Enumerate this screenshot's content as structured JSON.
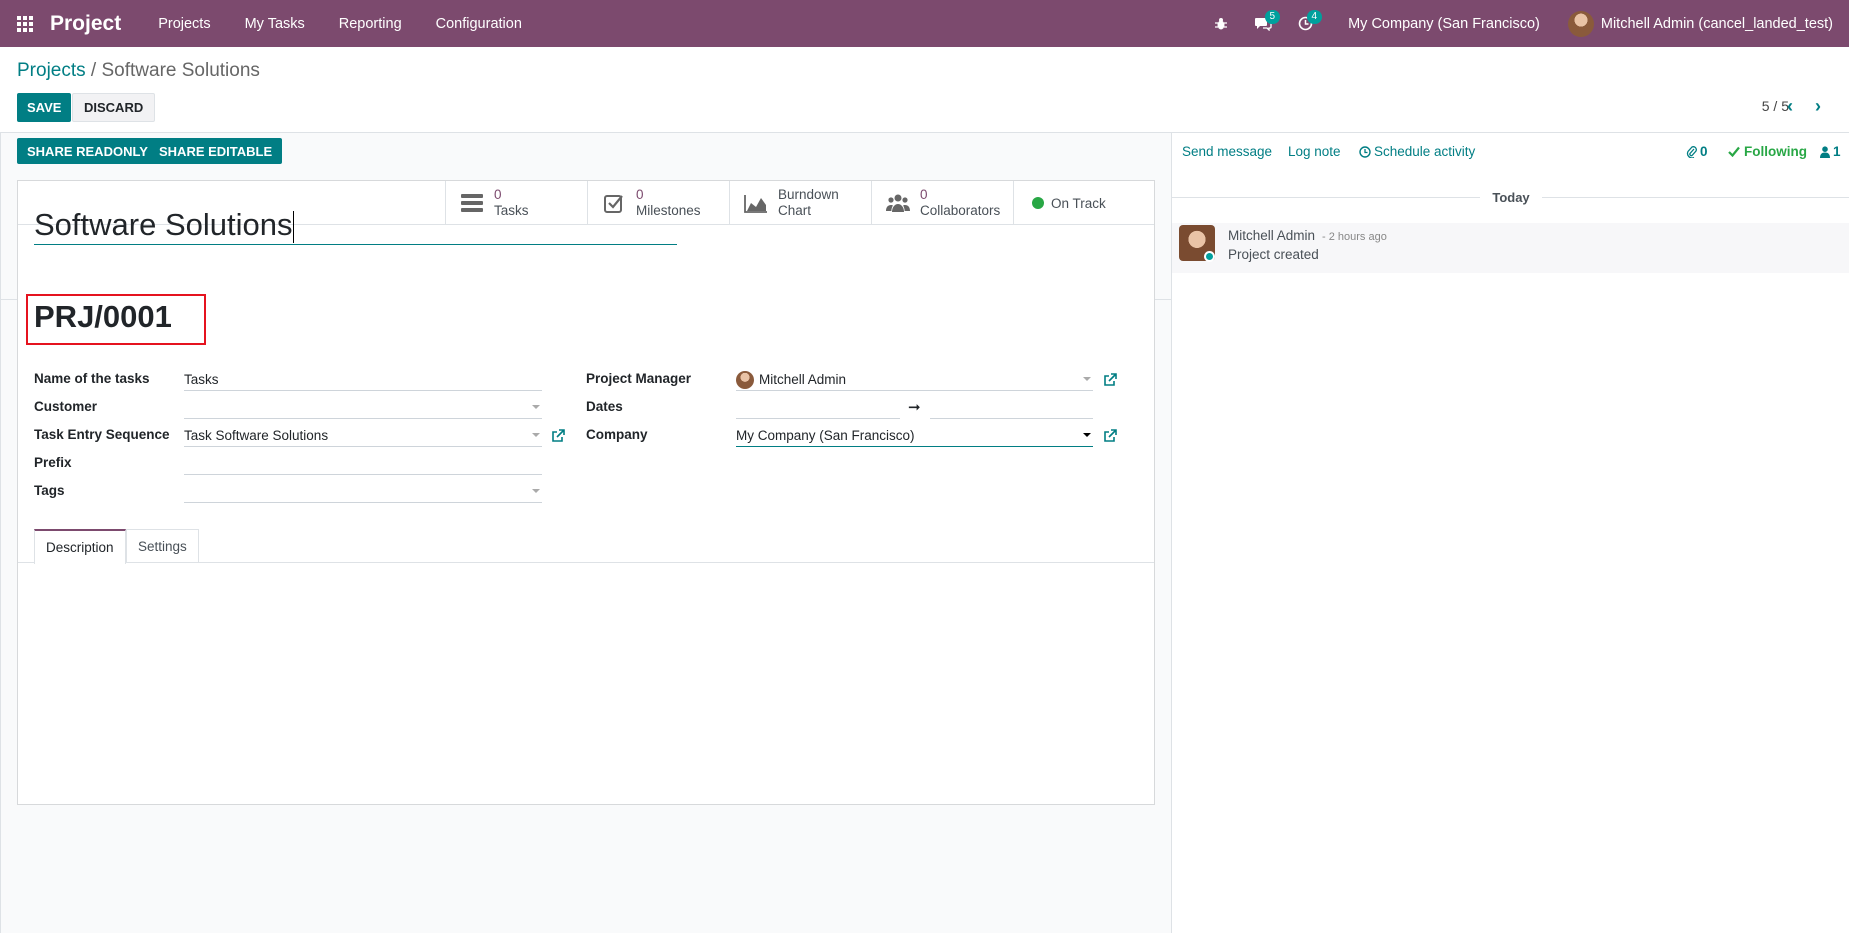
{
  "navbar": {
    "brand": "Project",
    "menu": [
      "Projects",
      "My Tasks",
      "Reporting",
      "Configuration"
    ],
    "messages_badge": "5",
    "activities_badge": "4",
    "company": "My Company (San Francisco)",
    "user": "Mitchell Admin (cancel_landed_test)"
  },
  "breadcrumb": {
    "parent": "Projects",
    "separator": "/",
    "current": "Software Solutions"
  },
  "buttons": {
    "save": "SAVE",
    "discard": "DISCARD",
    "share_readonly": "SHARE READONLY",
    "share_editable": "SHARE EDITABLE"
  },
  "pager": {
    "value": "5 / 5"
  },
  "stat_buttons": {
    "tasks": {
      "count": "0",
      "label": "Tasks"
    },
    "milestones": {
      "count": "0",
      "label": "Milestones"
    },
    "burndown": {
      "line1": "Burndown",
      "line2": "Chart"
    },
    "collaborators": {
      "count": "0",
      "label": "Collaborators"
    },
    "status": "On Track"
  },
  "form": {
    "name": "Software Solutions",
    "sequence": "PRJ/0001",
    "fields": {
      "task_name": {
        "label": "Name of the tasks",
        "value": "Tasks"
      },
      "customer": {
        "label": "Customer",
        "value": ""
      },
      "task_sequence": {
        "label": "Task Entry Sequence",
        "value": "Task Software Solutions"
      },
      "prefix": {
        "label": "Prefix",
        "value": ""
      },
      "tags": {
        "label": "Tags",
        "value": ""
      },
      "manager": {
        "label": "Project Manager",
        "value": "Mitchell Admin"
      },
      "dates": {
        "label": "Dates",
        "start": "",
        "end": "",
        "arrow": "➞"
      },
      "company": {
        "label": "Company",
        "value": "My Company (San Francisco)"
      }
    },
    "tabs": [
      "Description",
      "Settings"
    ]
  },
  "chatter": {
    "send_message": "Send message",
    "log_note": "Log note",
    "schedule_activity": "Schedule activity",
    "attachments": "0",
    "following": "Following",
    "followers": "1",
    "date_separator": "Today",
    "messages": [
      {
        "author": "Mitchell Admin",
        "date": "- 2 hours ago",
        "body": "Project created"
      }
    ]
  },
  "colors": {
    "navbar": "#7c4a6e",
    "primary": "#017e84",
    "highlight": "#e5131f",
    "following": "#28a745"
  }
}
